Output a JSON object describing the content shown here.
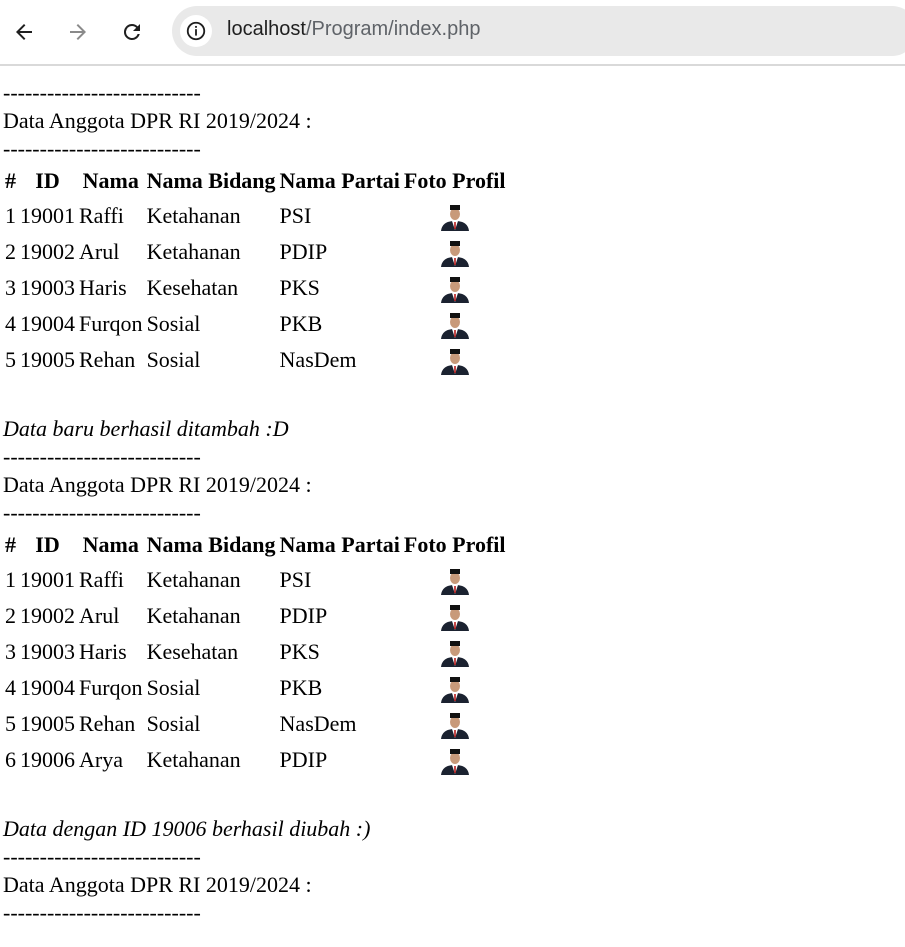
{
  "browser": {
    "url_host": "localhost",
    "url_path": "/Program/index.php"
  },
  "page": {
    "separator": "---------------------------",
    "heading": "Data Anggota DPR RI 2019/2024 :",
    "headers": [
      "#",
      "ID",
      "Nama",
      "Nama Bidang",
      "Nama Partai",
      "Foto Profil"
    ],
    "sections": [
      {
        "message": "",
        "rows": [
          {
            "no": "1",
            "id": "19001",
            "nama": "Raffi",
            "bidang": "Ketahanan",
            "partai": "PSI"
          },
          {
            "no": "2",
            "id": "19002",
            "nama": "Arul",
            "bidang": "Ketahanan",
            "partai": "PDIP"
          },
          {
            "no": "3",
            "id": "19003",
            "nama": "Haris",
            "bidang": "Kesehatan",
            "partai": "PKS"
          },
          {
            "no": "4",
            "id": "19004",
            "nama": "Furqon",
            "bidang": "Sosial",
            "partai": "PKB"
          },
          {
            "no": "5",
            "id": "19005",
            "nama": "Rehan",
            "bidang": "Sosial",
            "partai": "NasDem"
          }
        ]
      },
      {
        "message": "Data baru berhasil ditambah :D",
        "rows": [
          {
            "no": "1",
            "id": "19001",
            "nama": "Raffi",
            "bidang": "Ketahanan",
            "partai": "PSI"
          },
          {
            "no": "2",
            "id": "19002",
            "nama": "Arul",
            "bidang": "Ketahanan",
            "partai": "PDIP"
          },
          {
            "no": "3",
            "id": "19003",
            "nama": "Haris",
            "bidang": "Kesehatan",
            "partai": "PKS"
          },
          {
            "no": "4",
            "id": "19004",
            "nama": "Furqon",
            "bidang": "Sosial",
            "partai": "PKB"
          },
          {
            "no": "5",
            "id": "19005",
            "nama": "Rehan",
            "bidang": "Sosial",
            "partai": "NasDem"
          },
          {
            "no": "6",
            "id": "19006",
            "nama": "Arya",
            "bidang": "Ketahanan",
            "partai": "PDIP"
          }
        ]
      },
      {
        "message": "Data dengan ID 19006 berhasil diubah :)",
        "rows": []
      }
    ]
  }
}
